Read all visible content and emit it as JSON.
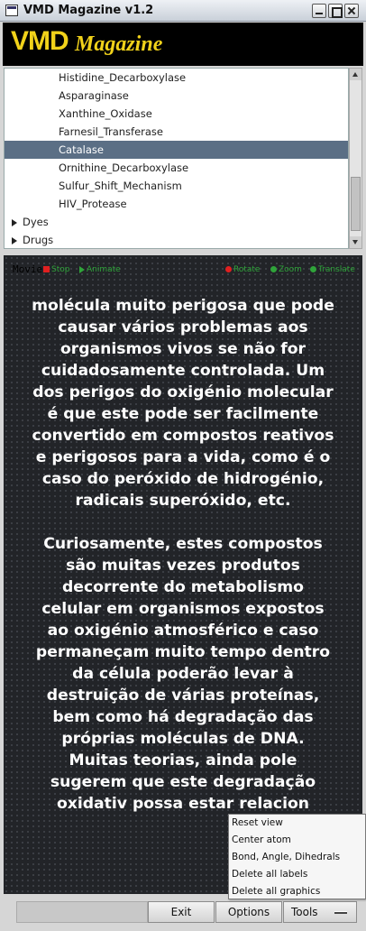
{
  "window": {
    "title": "VMD Magazine v1.2"
  },
  "logo": {
    "main": "VMD",
    "sub": "Magazine"
  },
  "tree": {
    "children": [
      {
        "label": "Histidine_Decarboxylase",
        "selected": false
      },
      {
        "label": "Asparaginase",
        "selected": false
      },
      {
        "label": "Xanthine_Oxidase",
        "selected": false
      },
      {
        "label": "Farnesil_Transferase",
        "selected": false
      },
      {
        "label": "Catalase",
        "selected": true
      },
      {
        "label": "Ornithine_Decarboxylase",
        "selected": false
      },
      {
        "label": "Sulfur_Shift_Mechanism",
        "selected": false
      },
      {
        "label": "HIV_Protease",
        "selected": false
      }
    ],
    "folders": [
      "Dyes",
      "Drugs"
    ]
  },
  "viewer": {
    "controls": {
      "movie": "Movie",
      "stop": "Stop",
      "animate": "Animate",
      "rotate": "Rotate",
      "zoom": "Zoom",
      "translate": "Translate"
    },
    "paragraphs": [
      "molécula muito perigosa que pode causar vários problemas aos organismos vivos se não for cuidadosamente controlada. Um dos perigos do oxigénio molecular é que este pode ser facilmente convertido em compostos reativos e perigosos para a vida, como é o caso do peróxido de hidrogénio, radicais superóxido, etc.",
      "Curiosamente, estes compostos são muitas vezes produtos decorrente do metabolismo celular em organismos expostos ao oxigénio atmosférico e caso permaneçam muito tempo dentro da célula poderão levar à destruição de várias proteínas, bem como há degradação das próprias moléculas de DNA. Muitas teorias, ainda pole sugerem que este degradação oxidativ possa estar relacion"
    ]
  },
  "toolbar": {
    "exit": "Exit",
    "options": "Options",
    "tools": "Tools"
  },
  "menu": {
    "items": [
      "Reset view",
      "Center atom",
      "Bond, Angle, Dihedrals",
      "Delete all labels",
      "Delete all graphics"
    ]
  },
  "colors": {
    "logo": "#f1d21a",
    "selection": "#5b6f85",
    "viewer_bg": "#222428",
    "control_green": "#2fa43a",
    "stop_red": "#e02020"
  }
}
